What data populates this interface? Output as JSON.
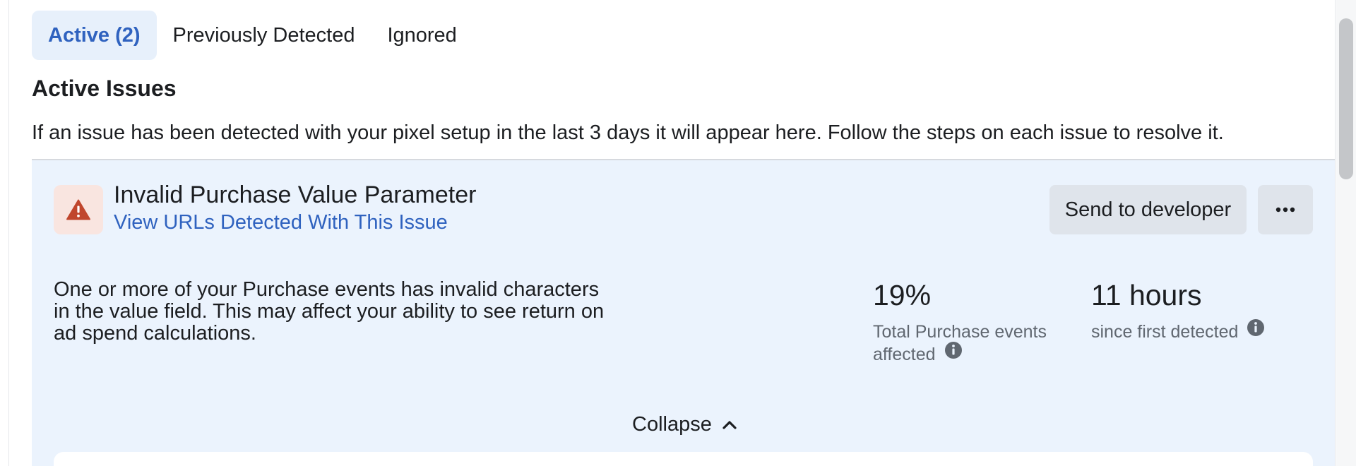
{
  "tabs": [
    {
      "label": "Active (2)",
      "active": true
    },
    {
      "label": "Previously Detected",
      "active": false
    },
    {
      "label": "Ignored",
      "active": false
    }
  ],
  "section": {
    "title": "Active Issues",
    "description": "If an issue has been detected with your pixel setup in the last 3 days it will appear here. Follow the steps on each issue to resolve it."
  },
  "issue": {
    "icon": "warning-triangle-icon",
    "title": "Invalid Purchase Value Parameter",
    "link": "View URLs Detected With This Issue",
    "send_button": "Send to developer",
    "more_icon": "more-dots-icon",
    "body": "One or more of your Purchase events has invalid characters in the value field. This may affect your ability to see return on ad spend calculations.",
    "stats": [
      {
        "value": "19%",
        "label_line1": "Total Purchase events",
        "label_line2": "affected"
      },
      {
        "value": "11 hours",
        "label": "since first detected"
      }
    ],
    "collapse_label": "Collapse"
  },
  "colors": {
    "accent": "#2f62bf",
    "card_bg": "#ebf3fd",
    "warning": "#c0462d",
    "tab_active_bg": "#e7f0fb"
  }
}
